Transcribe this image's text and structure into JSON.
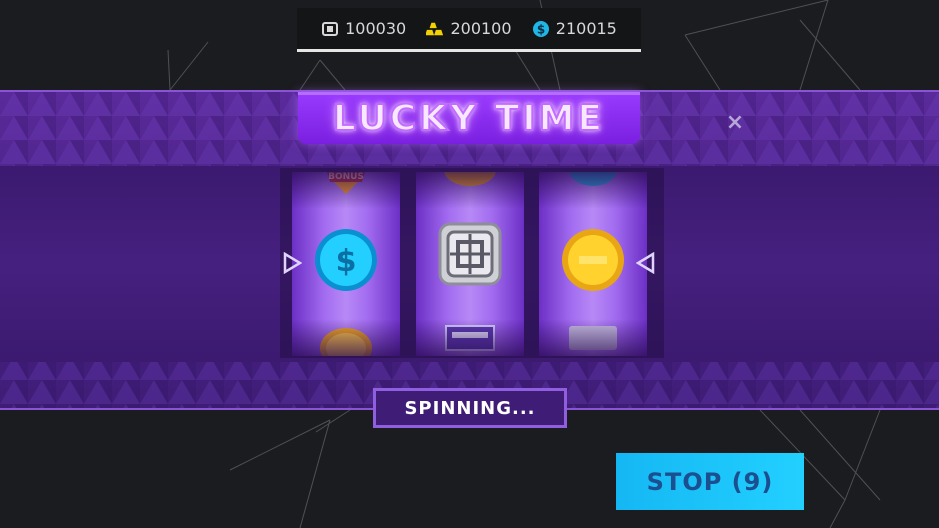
{
  "resources": [
    {
      "icon": "microchip-icon",
      "value": "100030"
    },
    {
      "icon": "gold-bars-icon",
      "value": "200100"
    },
    {
      "icon": "coin-dollar-icon",
      "value": "210015"
    }
  ],
  "title": "LUCKY TIME",
  "close_label": "×",
  "reels": [
    {
      "top": "bonus-badge-icon",
      "center": "blue-dollar-coin-icon",
      "bottom": "gold-coin-icon"
    },
    {
      "top": "gold-coin-icon",
      "center": "microchip-icon",
      "bottom": "bars-icon"
    },
    {
      "top": "blue-coin-icon",
      "center": "gold-coin-icon",
      "bottom": "silver-bar-icon"
    }
  ],
  "reel_top_text": "BONUS",
  "status_label": "SPINNING...",
  "stop_button_label": "STOP (9)",
  "colors": {
    "band": "#4a2386",
    "title": "#8a2be2",
    "stop": "#15b7f3",
    "accent": "#8f5fe0"
  }
}
